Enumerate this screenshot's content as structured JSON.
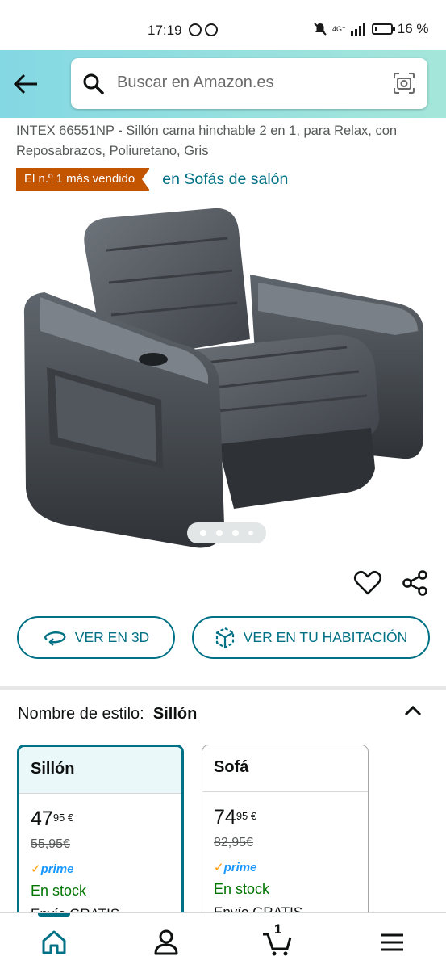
{
  "status_bar": {
    "time": "17:19",
    "network": "4G⁺",
    "battery_percent": "16 %",
    "battery_level": 0.16
  },
  "search": {
    "placeholder": "Buscar en Amazon.es"
  },
  "product": {
    "title": "INTEX 66551NP - Sillón cama hinchable 2 en 1, para Relax, con Reposabrazos, Poliuretano, Gris",
    "bestseller_badge": "El n.º 1 más vendido",
    "bestseller_category": "en Sofás de salón",
    "image_dots": 4,
    "active_image": 1
  },
  "actions": {
    "view_3d": "VER EN 3D",
    "view_room": "VER EN TU HABITACIÓN"
  },
  "style_selector": {
    "label": "Nombre de estilo:",
    "selected": "Sillón",
    "options": [
      {
        "name": "Sillón",
        "price_whole": "47",
        "price_fraction": "95 €",
        "old_price": "55,95€",
        "prime": "prime",
        "stock": "En stock",
        "shipping": "Envío GRATIS"
      },
      {
        "name": "Sofá",
        "price_whole": "74",
        "price_fraction": "95 €",
        "old_price": "82,95€",
        "prime": "prime",
        "stock": "En stock",
        "shipping": "Envío GRATIS"
      }
    ]
  },
  "bottom_nav": {
    "cart_count": "1",
    "items": [
      "home-icon",
      "account-icon",
      "cart-icon",
      "menu-icon"
    ]
  },
  "colors": {
    "accent_teal": "#007185",
    "bestseller_orange": "#c45500",
    "in_stock_green": "#007600",
    "prime_blue": "#1a98ff",
    "header_gradient_start": "#84d8e3",
    "header_gradient_end": "#a5e6da"
  }
}
